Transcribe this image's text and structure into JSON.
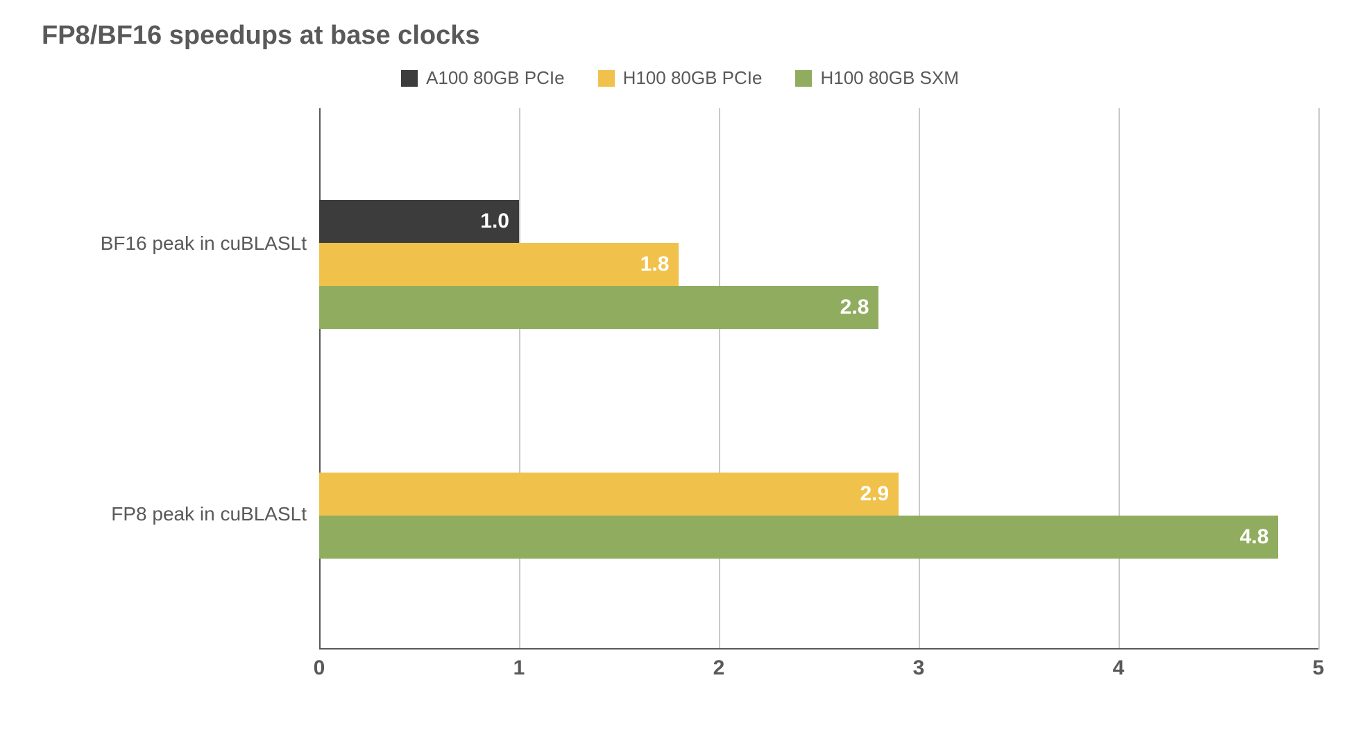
{
  "chart_data": {
    "type": "bar",
    "orientation": "horizontal",
    "title": "FP8/BF16 speedups at base clocks",
    "xlabel": "",
    "ylabel": "",
    "xlim": [
      0,
      5
    ],
    "x_ticks": [
      0,
      1,
      2,
      3,
      4,
      5
    ],
    "categories": [
      "BF16 peak in cuBLASLt",
      "FP8 peak in cuBLASLt"
    ],
    "series": [
      {
        "name": "A100 80GB PCIe",
        "color": "#3c3c3c",
        "values": [
          1.0,
          null
        ]
      },
      {
        "name": "H100 80GB PCIe",
        "color": "#f0c24b",
        "values": [
          1.8,
          2.9
        ]
      },
      {
        "name": "H100 80GB SXM",
        "color": "#90ad5f",
        "values": [
          2.8,
          4.8
        ]
      }
    ],
    "legend_position": "top"
  }
}
